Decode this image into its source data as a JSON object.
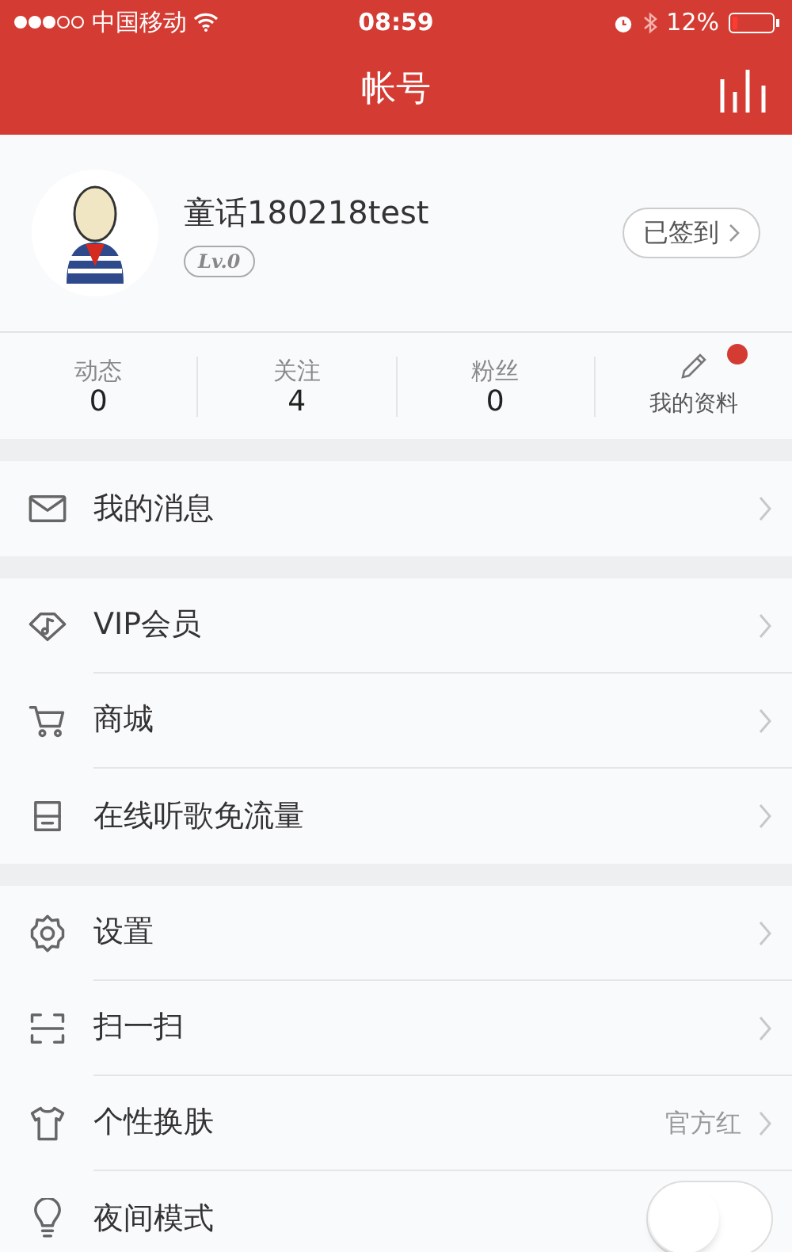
{
  "status_bar": {
    "carrier": "中国移动",
    "time": "08:59",
    "battery": "12%"
  },
  "nav": {
    "title": "帐号"
  },
  "profile": {
    "name": "童话180218test",
    "level": "Lv.0",
    "checkin": "已签到"
  },
  "stats": [
    {
      "kind": "count",
      "label": "动态",
      "value": "0"
    },
    {
      "kind": "count",
      "label": "关注",
      "value": "4"
    },
    {
      "kind": "count",
      "label": "粉丝",
      "value": "0"
    },
    {
      "kind": "link",
      "label": "我的资料",
      "dot": true
    }
  ],
  "sections": [
    [
      {
        "kind": "link",
        "label": "我的消息"
      }
    ],
    [
      {
        "kind": "link",
        "label": "VIP会员"
      },
      {
        "kind": "link",
        "label": "商城"
      },
      {
        "kind": "link",
        "label": "在线听歌免流量"
      }
    ],
    [
      {
        "kind": "link",
        "label": "设置"
      },
      {
        "kind": "link",
        "label": "扫一扫"
      },
      {
        "kind": "link",
        "label": "个性换肤",
        "value": "官方红"
      },
      {
        "kind": "toggle",
        "label": "夜间模式",
        "on": false
      }
    ]
  ]
}
